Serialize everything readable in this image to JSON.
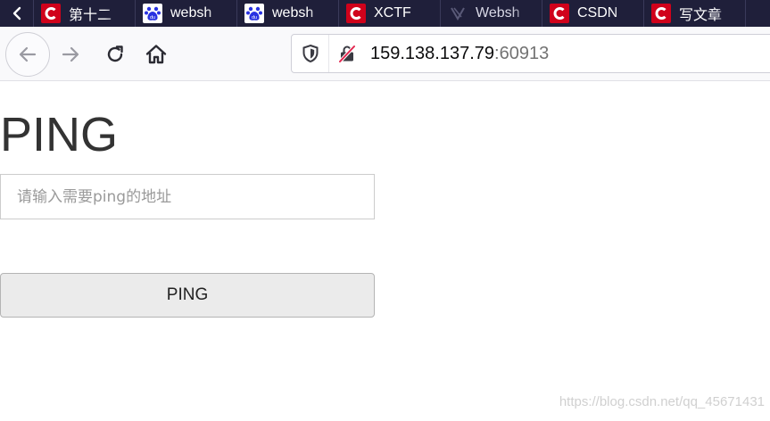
{
  "browser": {
    "tabs": [
      {
        "label": "第十二",
        "icon": "csdn-icon"
      },
      {
        "label": "websh",
        "icon": "baidu-icon"
      },
      {
        "label": "websh",
        "icon": "baidu-icon"
      },
      {
        "label": "XCTF",
        "icon": "csdn-icon"
      },
      {
        "label": "Websh",
        "icon": "generic-page-icon"
      },
      {
        "label": "CSDN",
        "icon": "csdn-icon"
      },
      {
        "label": "写文章",
        "icon": "csdn-icon"
      }
    ],
    "address_bar": {
      "host": "159.138.137.79",
      "port": ":60913"
    },
    "colors": {
      "tabstrip_bg": "#1f1f3a",
      "csdn_red": "#d0021b",
      "baidu_blue": "#2932e1"
    }
  },
  "page": {
    "title": "PING",
    "input_placeholder": "请输入需要ping的地址",
    "input_value": "",
    "button_label": "PING"
  },
  "watermark": "https://blog.csdn.net/qq_45671431"
}
